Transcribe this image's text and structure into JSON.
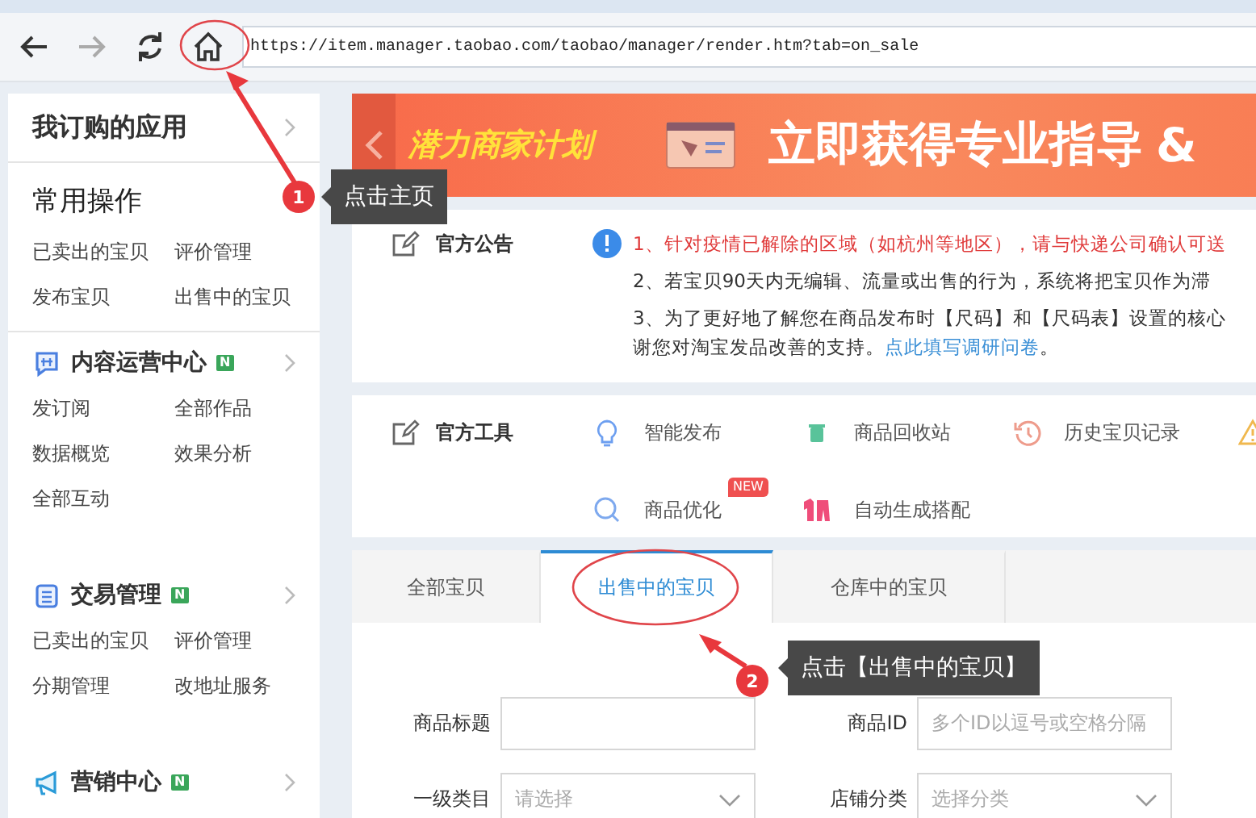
{
  "browser": {
    "address": "https://item.manager.taobao.com/taobao/manager/render.htm?tab=on_sale"
  },
  "sidebar": {
    "apps_title": "我订购的应用",
    "sections": [
      {
        "title": "常用操作",
        "kind": "plain",
        "items": [
          "已卖出的宝贝",
          "评价管理",
          "发布宝贝",
          "出售中的宝贝"
        ]
      },
      {
        "title": "内容运营中心",
        "kind": "chat",
        "badge": "N",
        "items": [
          "发订阅",
          "全部作品",
          "数据概览",
          "效果分析",
          "全部互动"
        ]
      },
      {
        "title": "交易管理",
        "kind": "list",
        "badge": "N",
        "items": [
          "已卖出的宝贝",
          "评价管理",
          "分期管理",
          "改地址服务"
        ]
      },
      {
        "title": "营销中心",
        "kind": "megaphone",
        "badge": "N"
      }
    ]
  },
  "banner": {
    "tag": "潜力商家计划",
    "headline": "立即获得专业指导",
    "tail": "&"
  },
  "notice": {
    "label": "官方公告",
    "items": [
      {
        "text": "1、针对疫情已解除的区域（如杭州等地区），请与快递公司确认可送",
        "kind": "alert"
      },
      {
        "text": "2、若宝贝90天内无编辑、流量或出售的行为，系统将把宝贝作为滞",
        "kind": "normal"
      },
      {
        "text": "3、为了更好地了解您在商品发布时【尺码】和【尺码表】设置的核心",
        "kind": "normal"
      }
    ],
    "footer": {
      "text": "谢您对淘宝发品改善的支持。",
      "link": "点此填写调研问卷",
      "tail": "。"
    }
  },
  "tools": {
    "label": "官方工具",
    "items": [
      {
        "label": "智能发布",
        "kind": "bulb"
      },
      {
        "label": "商品回收站",
        "kind": "trash"
      },
      {
        "label": "历史宝贝记录",
        "kind": "history"
      },
      {
        "kind": "warning"
      },
      {
        "label": "商品优化",
        "kind": "search",
        "badge": "NEW"
      },
      {
        "label": "自动生成搭配",
        "kind": "clothes"
      }
    ]
  },
  "tabs": [
    {
      "label": "全部宝贝",
      "selected": false
    },
    {
      "label": "出售中的宝贝",
      "selected": true
    },
    {
      "label": "仓库中的宝贝",
      "selected": false
    }
  ],
  "form": {
    "fields": [
      {
        "label": "商品标题",
        "kind": "text"
      },
      {
        "label": "商品ID",
        "kind": "text",
        "placeholder": "多个ID以逗号或空格分隔"
      },
      {
        "label": "一级类目",
        "kind": "select",
        "placeholder": "请选择"
      },
      {
        "label": "店铺分类",
        "kind": "select",
        "placeholder": "选择分类"
      }
    ]
  },
  "callouts": [
    {
      "number": "1",
      "text": "点击主页"
    },
    {
      "number": "2",
      "text": "点击【出售中的宝贝】"
    }
  ]
}
